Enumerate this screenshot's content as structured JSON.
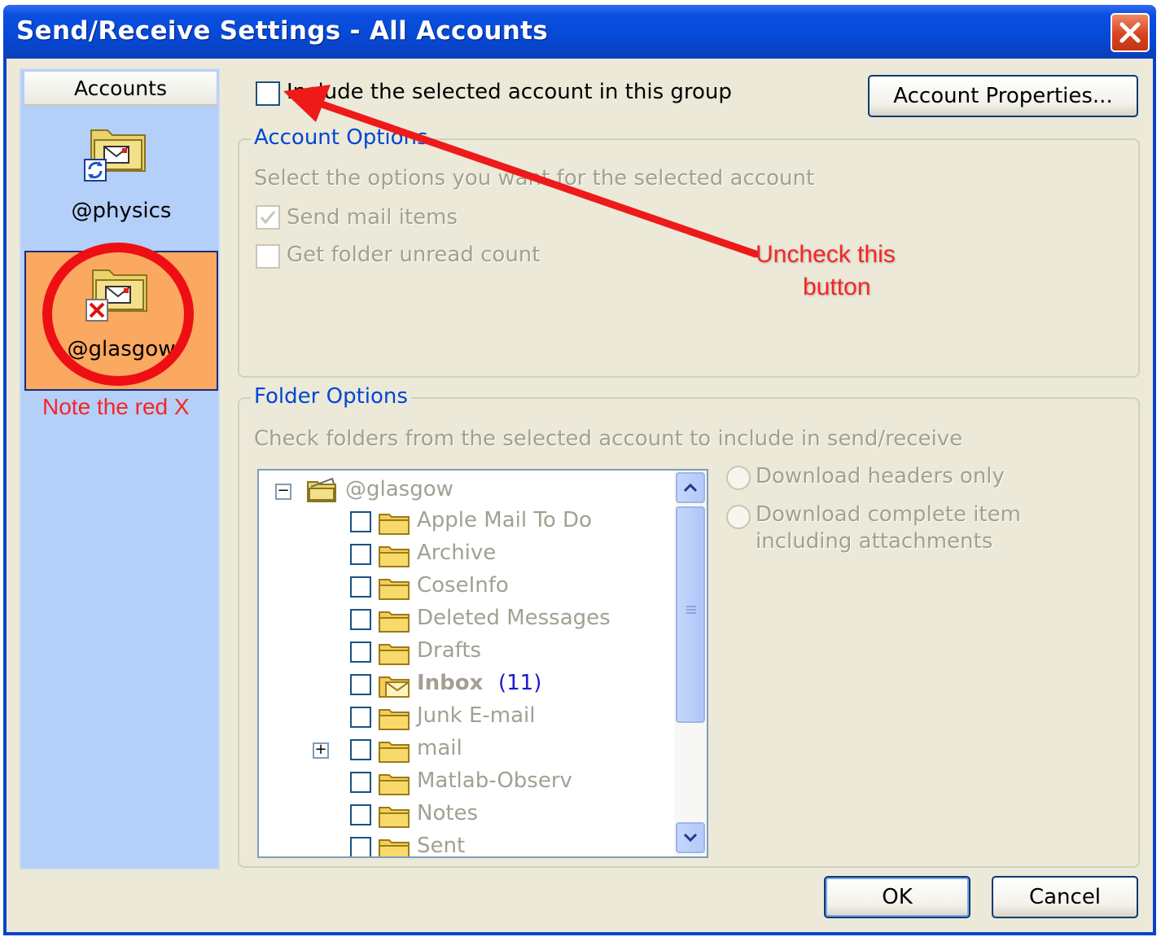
{
  "window": {
    "title": "Send/Receive Settings - All Accounts"
  },
  "accounts": {
    "header": "Accounts",
    "items": [
      {
        "label": "@physics"
      },
      {
        "label": "@glasgow"
      }
    ],
    "note": "Note the red X"
  },
  "include_checkbox": {
    "label": "Include the selected account in this group",
    "checked": false
  },
  "account_properties_button": "Account Properties...",
  "account_options": {
    "title": "Account Options",
    "description": "Select the options you want for the selected account",
    "send_mail_items": {
      "label": "Send mail items",
      "checked": true
    },
    "get_unread_count": {
      "label": "Get folder unread count",
      "checked": false
    }
  },
  "folder_options": {
    "title": "Folder Options",
    "description": "Check folders from the selected account to include in send/receive",
    "root": "@glasgow",
    "folders": [
      {
        "name": "Apple Mail To Do"
      },
      {
        "name": "Archive"
      },
      {
        "name": "CoseInfo"
      },
      {
        "name": "Deleted Messages"
      },
      {
        "name": "Drafts"
      },
      {
        "name": "Inbox",
        "count": "(11)"
      },
      {
        "name": "Junk E-mail"
      },
      {
        "name": "mail"
      },
      {
        "name": "Matlab-Observ"
      },
      {
        "name": "Notes"
      },
      {
        "name": "Sent"
      }
    ],
    "radio_headers": "Download headers only",
    "radio_complete": "Download complete item including attachments"
  },
  "annotation": {
    "line1": "Uncheck this",
    "line2": "button"
  },
  "buttons": {
    "ok": "OK",
    "cancel": "Cancel"
  },
  "colors": {
    "titlebar": "#0649d6",
    "dialog_bg": "#ece9d8",
    "accounts_bg": "#b4cff8",
    "selected_account": "#fba860",
    "annotation_red": "#f52626",
    "group_title": "#0046d5",
    "inbox_count": "#1a1ad0"
  },
  "icons": [
    "close-icon",
    "send-receive-folder-icon",
    "error-x-icon",
    "folder-icon",
    "inbox-folder-icon",
    "collapse-icon",
    "expand-icon",
    "scroll-up-icon",
    "scroll-down-icon",
    "checkmark-icon",
    "annotation-arrow"
  ]
}
